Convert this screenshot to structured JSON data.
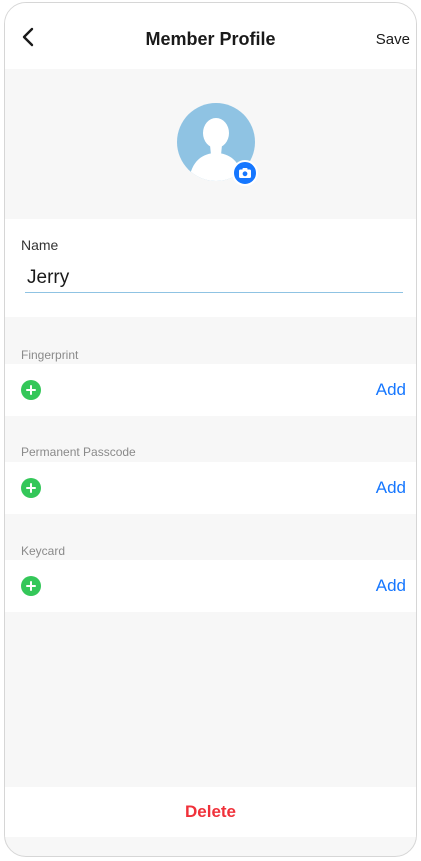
{
  "header": {
    "title": "Member Profile",
    "save_label": "Save",
    "back_icon": "chevron-left-icon"
  },
  "avatar": {
    "icon": "user-silhouette-icon",
    "badge_icon": "camera-icon",
    "background_color": "#8fc3e3",
    "badge_color": "#1677ff"
  },
  "name_field": {
    "label": "Name",
    "value": "Jerry"
  },
  "sections": [
    {
      "title": "Fingerprint",
      "action_label": "Add",
      "icon": "plus-circle-icon"
    },
    {
      "title": "Permanent Passcode",
      "action_label": "Add",
      "icon": "plus-circle-icon"
    },
    {
      "title": "Keycard",
      "action_label": "Add",
      "icon": "plus-circle-icon"
    }
  ],
  "footer": {
    "delete_label": "Delete"
  },
  "colors": {
    "accent": "#1677ff",
    "add_icon": "#34c759",
    "danger": "#f0313a",
    "background": "#f7f7f7"
  }
}
